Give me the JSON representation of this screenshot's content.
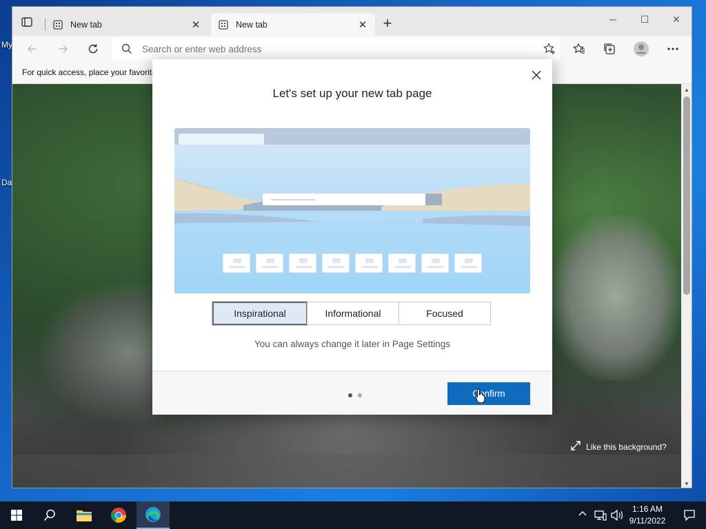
{
  "desktop": {
    "icon_labels": [
      "My",
      "Da"
    ]
  },
  "browser": {
    "tabs": [
      {
        "label": "New tab",
        "active": false
      },
      {
        "label": "New tab",
        "active": true
      }
    ],
    "address": {
      "placeholder": "Search or enter web address",
      "value": ""
    },
    "favorites_bar_text": "For quick access, place your favorites here on the favorites bar."
  },
  "dialog": {
    "title": "Let's set up your new tab page",
    "layout_options": [
      {
        "label": "Inspirational",
        "selected": true
      },
      {
        "label": "Informational",
        "selected": false
      },
      {
        "label": "Focused",
        "selected": false
      }
    ],
    "hint": "You can always change it later in Page Settings",
    "page_indicator": {
      "current": 1,
      "total": 2
    },
    "confirm_label": "Confirm"
  },
  "background_prompt": "Like this background?",
  "taskbar": {
    "time": "1:16 AM",
    "date": "9/11/2022",
    "pinned": [
      "search-icon",
      "file-explorer-icon",
      "chrome-icon",
      "edge-icon"
    ],
    "active_app": "edge-icon"
  },
  "colors": {
    "accent": "#0f6cbd",
    "selected_option_bg": "#dfe9f5",
    "taskbar": "#101826"
  }
}
